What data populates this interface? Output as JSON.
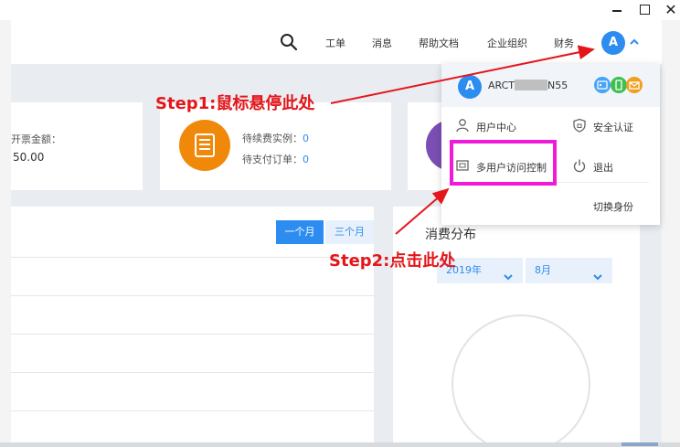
{
  "window": {
    "min_icon": "minimize-icon",
    "max_icon": "maximize-icon",
    "close_icon": "close-icon",
    "close_glyph": "✕"
  },
  "topnav": {
    "search_icon": "search-icon",
    "items": [
      "工单",
      "消息",
      "帮助文档",
      "企业组织",
      "财务"
    ],
    "avatar_letter": "A",
    "caret_icon": "chevron-up-icon"
  },
  "cards": {
    "card1": {
      "label": "开票金额：",
      "value": "50.00"
    },
    "card2": {
      "icon": "document-list-icon",
      "rows": [
        {
          "label": "待续费实例：",
          "value": "0"
        },
        {
          "label": "待支付订单：",
          "value": "0"
        }
      ]
    }
  },
  "main_panel": {
    "toggle_month": "一个月",
    "toggle_three_months": "三个月"
  },
  "right_panel": {
    "title": "消费分布",
    "year": "2019年",
    "month": "8月"
  },
  "dropdown": {
    "avatar_letter": "A",
    "account_prefix": "ARCT",
    "account_suffix": "N55",
    "badges": [
      "id-card-icon",
      "phone-icon",
      "mail-icon"
    ],
    "items": {
      "user_center": "用户中心",
      "security": "安全认证",
      "multi_user": "多用户访问控制",
      "logout": "退出",
      "switch_identity": "切换身份"
    }
  },
  "annotations": {
    "step1": "Step1:鼠标悬停此处",
    "step2": "Step2:点击此处",
    "arrow_color": "#e4161b",
    "highlight_color": "#f01ad8"
  },
  "colors": {
    "accent": "#2d8cf0",
    "orange": "#f0890a",
    "purple": "#7a4fb4"
  }
}
